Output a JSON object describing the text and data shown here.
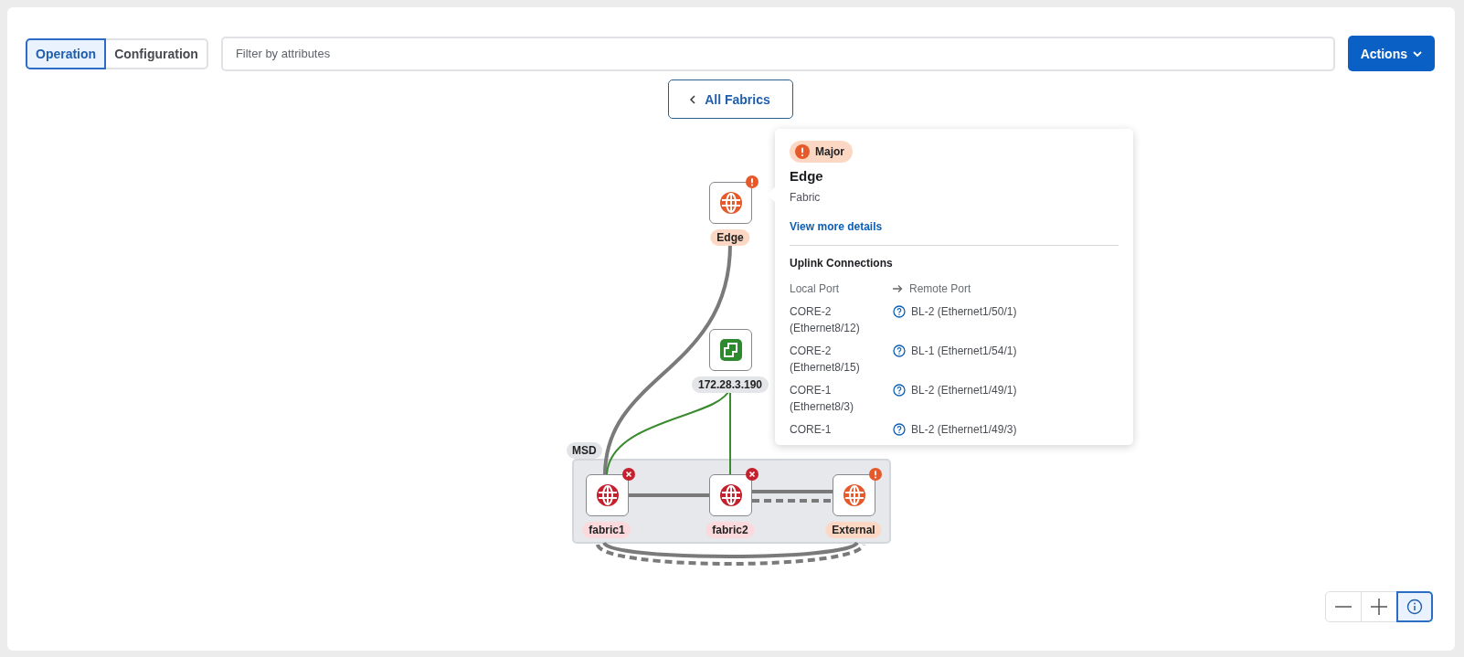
{
  "mode_tabs": [
    {
      "label": "Operation",
      "selected": true
    },
    {
      "label": "Configuration",
      "selected": false
    }
  ],
  "filter": {
    "placeholder": "Filter by attributes"
  },
  "actions_button": {
    "label": "Actions"
  },
  "back_button": {
    "label": "All Fabrics"
  },
  "group": {
    "label": "MSD"
  },
  "nodes": [
    {
      "label": "Edge",
      "kind": "fabric",
      "error": false,
      "warning": true
    },
    {
      "label": "172.28.3.190",
      "kind": "controller",
      "error": false,
      "warning": false
    },
    {
      "label": "fabric1",
      "kind": "fabric",
      "error": true,
      "warning": false
    },
    {
      "label": "fabric2",
      "kind": "fabric",
      "error": true,
      "warning": false
    },
    {
      "label": "External",
      "kind": "fabric",
      "error": false,
      "warning": true
    }
  ],
  "popup": {
    "severity": {
      "label": "Major",
      "warning": true
    },
    "title": "Edge",
    "subtitle": "Fabric",
    "link": "View more details",
    "section_title": "Uplink Connections",
    "columns": [
      "Local Port",
      "Remote Port"
    ],
    "rows": [
      {
        "local": "CORE-2 (Ethernet8/12)",
        "remote": "BL-2 (Ethernet1/50/1)"
      },
      {
        "local": "CORE-2 (Ethernet8/15)",
        "remote": "BL-1 (Ethernet1/54/1)"
      },
      {
        "local": "CORE-1 (Ethernet8/3)",
        "remote": "BL-2 (Ethernet1/49/1)"
      },
      {
        "local": "CORE-1",
        "remote": "BL-2 (Ethernet1/49/3)"
      }
    ]
  },
  "zoom_controls": [
    {
      "kind": "zoom-out",
      "selected": false
    },
    {
      "kind": "zoom-in",
      "selected": false
    },
    {
      "kind": "legend",
      "selected": true
    }
  ]
}
